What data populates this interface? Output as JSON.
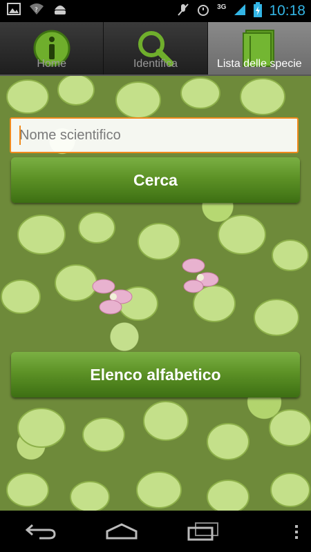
{
  "status_bar": {
    "time": "10:18",
    "network": "3G",
    "left_icons": [
      "image-icon",
      "wifi-question-icon",
      "android-icon"
    ],
    "right_icons": [
      "mute-icon",
      "alarm-icon",
      "signal-icon",
      "battery-icon"
    ]
  },
  "tabs": [
    {
      "label": "Home",
      "icon": "info-icon",
      "active": false
    },
    {
      "label": "Identifica",
      "icon": "magnifier-icon",
      "active": false
    },
    {
      "label": "Lista delle specie",
      "icon": "list-book-icon",
      "active": true
    }
  ],
  "search": {
    "placeholder": "Nome scientifico",
    "value": ""
  },
  "buttons": {
    "search_label": "Cerca",
    "alphabetical_label": "Elenco alfabetico"
  },
  "colors": {
    "accent_orange": "#f08a1c",
    "button_green": "#5d9226",
    "status_blue": "#33b5e5"
  },
  "nav_bar": {
    "icons": [
      "back-icon",
      "home-icon",
      "recent-apps-icon",
      "overflow-menu-icon"
    ]
  }
}
